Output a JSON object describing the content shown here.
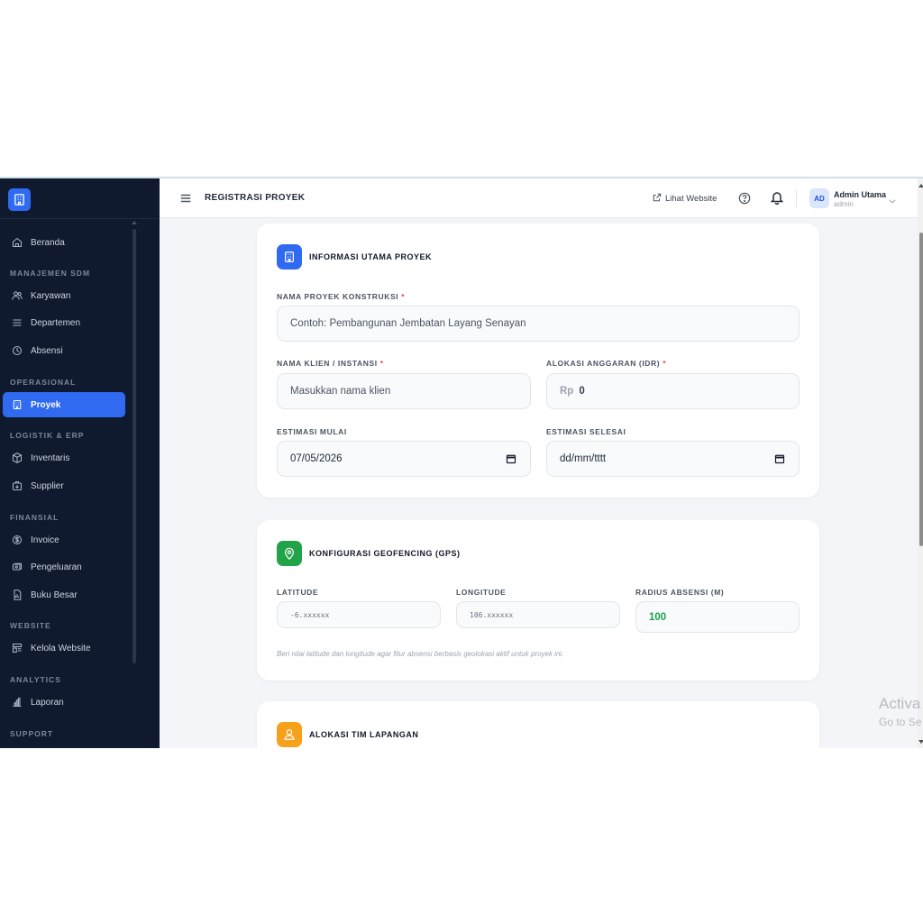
{
  "sidebar": {
    "items": [
      {
        "label": "Beranda",
        "icon": "home-icon"
      },
      {
        "label": "Karyawan",
        "icon": "users-icon"
      },
      {
        "label": "Departemen",
        "icon": "list-icon"
      },
      {
        "label": "Absensi",
        "icon": "clock-icon"
      },
      {
        "label": "Proyek",
        "icon": "building-icon",
        "active": true
      },
      {
        "label": "Inventaris",
        "icon": "box-icon"
      },
      {
        "label": "Supplier",
        "icon": "truck-icon"
      },
      {
        "label": "Invoice",
        "icon": "dollar-icon"
      },
      {
        "label": "Pengeluaran",
        "icon": "wallet-icon"
      },
      {
        "label": "Buku Besar",
        "icon": "book-icon"
      },
      {
        "label": "Kelola Website",
        "icon": "layout-icon"
      },
      {
        "label": "Laporan",
        "icon": "chart-icon"
      }
    ],
    "sections": {
      "sdm": "MANAJEMEN SDM",
      "operasional": "OPERASIONAL",
      "logistik": "LOGISTIK & ERP",
      "finansial": "FINANSIAL",
      "website": "WEBSITE",
      "analytics": "ANALYTICS",
      "support": "SUPPORT"
    }
  },
  "header": {
    "title": "REGISTRASI PROYEK",
    "website_link": "Lihat Website",
    "user_initials": "AD",
    "user_name": "Admin Utama",
    "user_role": "admin"
  },
  "card_main": {
    "title": "INFORMASI UTAMA PROYEK",
    "project_name_label": "NAMA PROYEK KONSTRUKSI",
    "project_name_placeholder": "Contoh: Pembangunan Jembatan Layang Senayan",
    "client_label": "NAMA KLIEN / INSTANSI",
    "client_placeholder": "Masukkan nama klien",
    "budget_label": "ALOKASI ANGGARAN (IDR)",
    "budget_prefix": "Rp",
    "budget_value": "0",
    "start_label": "ESTIMASI MULAI",
    "start_value": "07/05/2026",
    "end_label": "ESTIMASI SELESAI",
    "end_value": "dd/mm/tttt",
    "required_mark": "*"
  },
  "card_geo": {
    "title": "KONFIGURASI GEOFENCING (GPS)",
    "lat_label": "LATITUDE",
    "lat_placeholder": "-6.xxxxxx",
    "lng_label": "LONGITUDE",
    "lng_placeholder": "106.xxxxxx",
    "radius_label": "RADIUS ABSENSI (M)",
    "radius_value": "100",
    "note": "Beri nilai latitude dan longitude agar fitur absensi berbasis geolokasi aktif untuk proyek ini."
  },
  "card_team": {
    "title": "ALOKASI TIM LAPANGAN"
  },
  "watermark": {
    "line1": "Activa",
    "line2": "Go to Se"
  },
  "colors": {
    "sidebar_bg": "#0f1a2e",
    "accent": "#2f6af0",
    "geo_icon": "#22a34a",
    "team_icon": "#f5a11c",
    "radius_value": "#16a34a",
    "required": "#ef4444"
  }
}
